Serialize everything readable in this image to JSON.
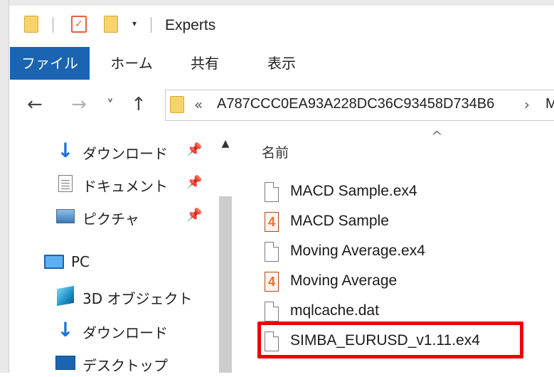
{
  "window": {
    "title": "Experts"
  },
  "quick_access": {
    "dropdown_indicator": "▾"
  },
  "ribbon": {
    "tabs": [
      {
        "label": "ファイル",
        "active": true
      },
      {
        "label": "ホーム"
      },
      {
        "label": "共有"
      },
      {
        "label": "表示"
      }
    ],
    "active_color": "#1a64b2"
  },
  "address": {
    "overflow_chevron": "«",
    "path_text": "A787CCC0EA93A228DC36C93458D734B6",
    "separator": "›",
    "next_segment": "M"
  },
  "nav_buttons": {
    "back": "←",
    "forward": "→",
    "recent": "˅",
    "up": "↑"
  },
  "nav_pane": {
    "quick_access_items": [
      {
        "label": "ダウンロード",
        "icon": "download-arrow-icon",
        "pinned": true
      },
      {
        "label": "ドキュメント",
        "icon": "documents-icon",
        "pinned": true
      },
      {
        "label": "ピクチャ",
        "icon": "pictures-icon",
        "pinned": true
      }
    ],
    "pc_label": "PC",
    "pc_items": [
      {
        "label": "3D オブジェクト",
        "icon": "3d-objects-icon"
      },
      {
        "label": "ダウンロード",
        "icon": "download-arrow-icon"
      },
      {
        "label": "デスクトップ",
        "icon": "desktop-icon"
      }
    ]
  },
  "file_list": {
    "column_header": "名前",
    "files": [
      {
        "name": "MACD Sample.ex4",
        "icon": "blank-file-icon"
      },
      {
        "name": "MACD Sample",
        "icon": "mq4-file-icon"
      },
      {
        "name": "Moving Average.ex4",
        "icon": "blank-file-icon"
      },
      {
        "name": "Moving Average",
        "icon": "mq4-file-icon"
      },
      {
        "name": "mqlcache.dat",
        "icon": "blank-file-icon"
      },
      {
        "name": "SIMBA_EURUSD_v1.11.ex4",
        "icon": "blank-file-icon",
        "highlighted": true
      }
    ],
    "highlight_color": "#ee0000"
  }
}
